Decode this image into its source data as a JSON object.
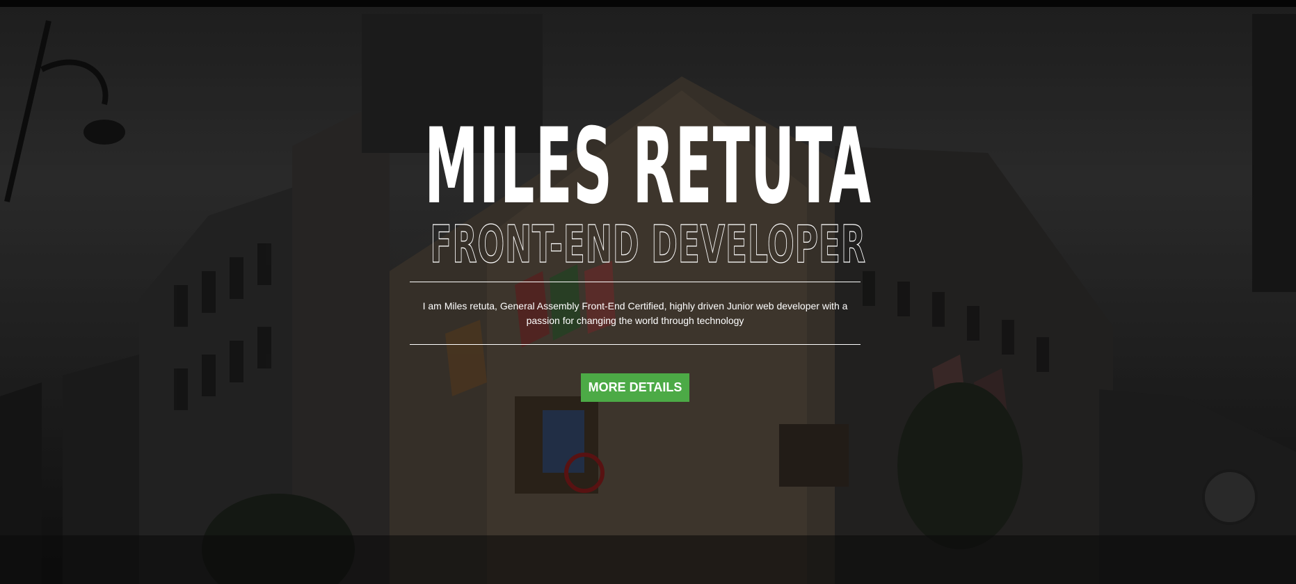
{
  "hero": {
    "name": "MILES RETUTA",
    "role": "FRONT-END DEVELOPER",
    "bio": "I am Miles retuta, General Assembly Front-End Certified, highly driven Junior web developer with a passion for changing the world through technology",
    "cta_label": "MORE DETAILS"
  },
  "colors": {
    "accent": "#4caa46",
    "text": "#ffffff",
    "background": "#2b2b2b"
  }
}
